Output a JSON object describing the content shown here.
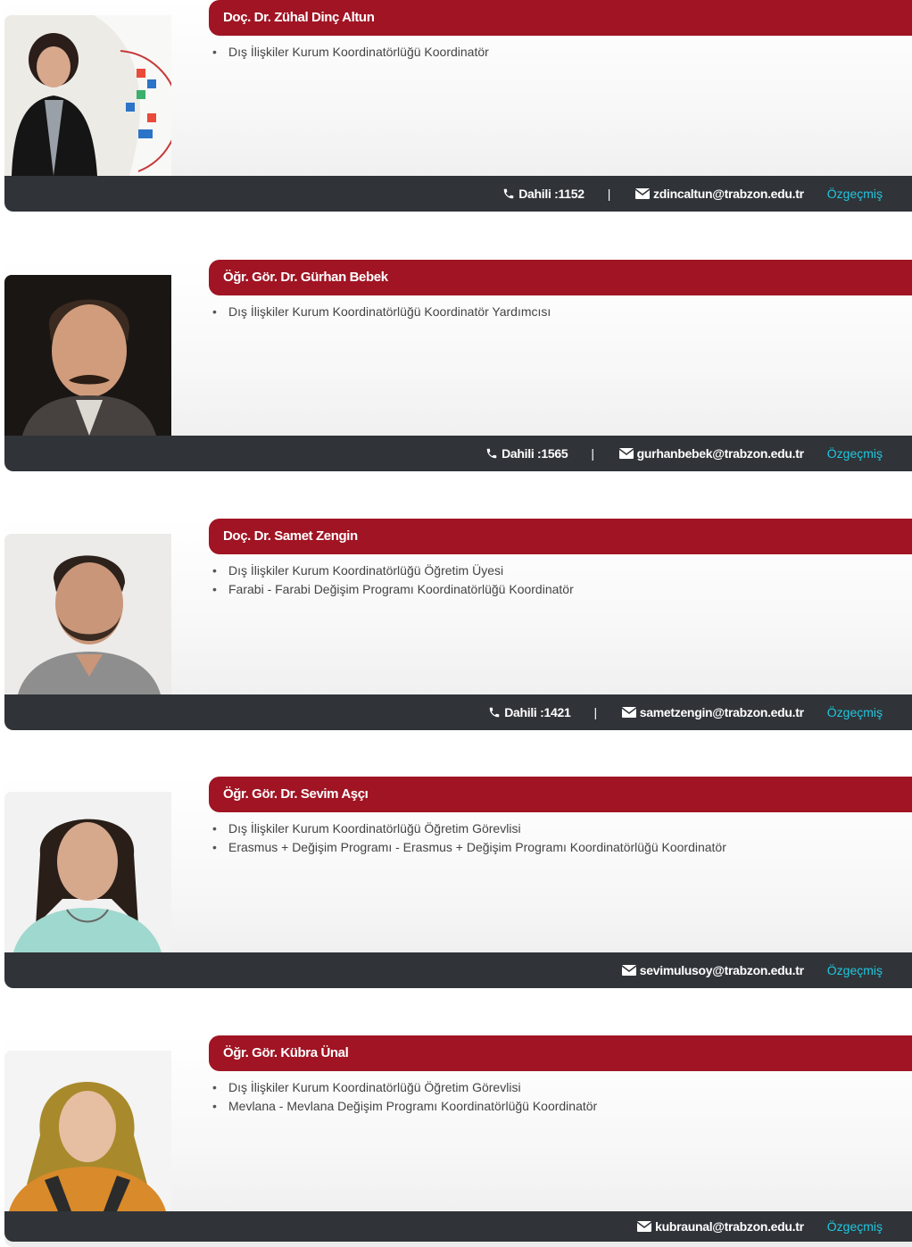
{
  "labels": {
    "ext_prefix": "Dahili : ",
    "separator": "|",
    "cv_link": "Özgeçmiş"
  },
  "colors": {
    "accent_red": "#a01423",
    "footer_dark": "#303438",
    "cv_link": "#1fc7e0"
  },
  "staff": [
    {
      "name": "Doç. Dr. Zühal Dinç Altun",
      "roles": [
        "Dış İlişkiler Kurum Koordinatörlüğü Koordinatör"
      ],
      "extension": "1152",
      "email": "zdincaltun@trabzon.edu.tr"
    },
    {
      "name": "Öğr. Gör. Dr. Gürhan Bebek",
      "roles": [
        "Dış İlişkiler Kurum Koordinatörlüğü Koordinatör Yardımcısı"
      ],
      "extension": "1565",
      "email": "gurhanbebek@trabzon.edu.tr"
    },
    {
      "name": "Doç. Dr. Samet Zengin",
      "roles": [
        "Dış İlişkiler Kurum Koordinatörlüğü Öğretim Üyesi",
        "Farabi - Farabi Değişim Programı Koordinatörlüğü Koordinatör"
      ],
      "extension": "1421",
      "email": "sametzengin@trabzon.edu.tr"
    },
    {
      "name": "Öğr. Gör. Dr. Sevim Aşçı",
      "roles": [
        "Dış İlişkiler Kurum Koordinatörlüğü Öğretim Görevlisi",
        "Erasmus + Değişim Programı - Erasmus + Değişim Programı Koordinatörlüğü Koordinatör"
      ],
      "extension": null,
      "email": "sevimulusoy@trabzon.edu.tr"
    },
    {
      "name": "Öğr. Gör. Kübra Ünal",
      "roles": [
        "Dış İlişkiler Kurum Koordinatörlüğü Öğretim Görevlisi",
        "Mevlana - Mevlana Değişim Programı Koordinatörlüğü Koordinatör"
      ],
      "extension": null,
      "email": "kubraunal@trabzon.edu.tr"
    }
  ]
}
